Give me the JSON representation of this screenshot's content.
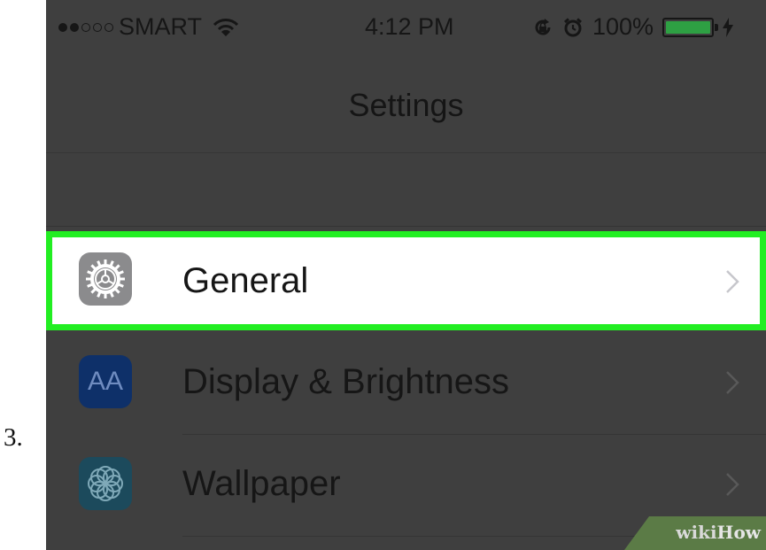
{
  "step_number": "3.",
  "status_bar": {
    "carrier": "SMART",
    "time": "4:12 PM",
    "battery_percent": "100%",
    "battery_level": 1.0,
    "signal_bars_filled": 2,
    "signal_bars_total": 5,
    "battery_color": "#2ea043"
  },
  "nav": {
    "title": "Settings"
  },
  "rows": [
    {
      "label": "General",
      "icon": "gear-icon",
      "highlighted": true,
      "highlight_color": "#22ee22"
    },
    {
      "label": "Display & Brightness",
      "icon": "display-brightness-icon",
      "icon_text": "AA"
    },
    {
      "label": "Wallpaper",
      "icon": "wallpaper-flower-icon"
    }
  ],
  "watermark": {
    "part1": "wiki",
    "part2": "How"
  }
}
